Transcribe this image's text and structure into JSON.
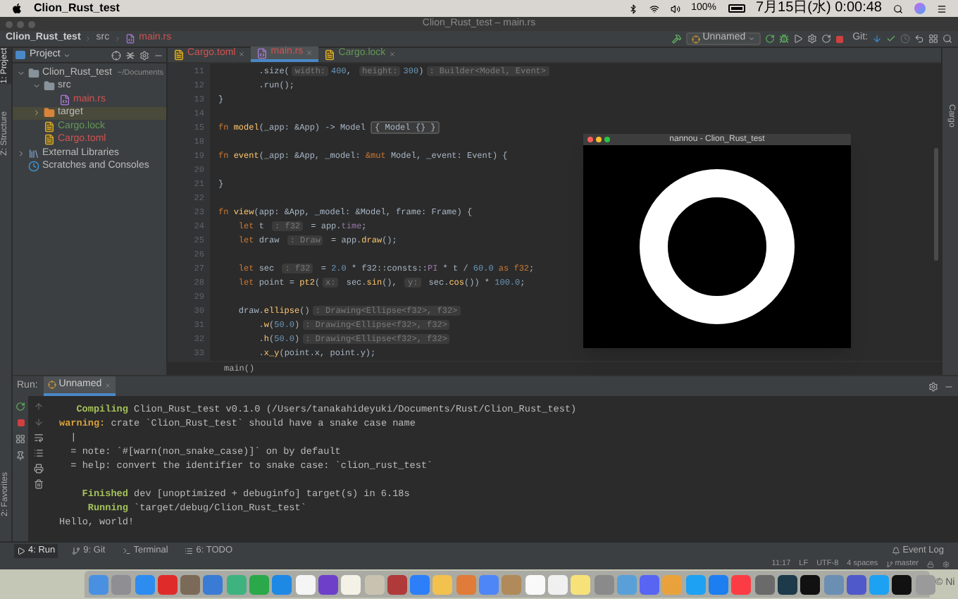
{
  "menu_bar": {
    "app_name": "Clion_Rust_test",
    "battery": "100%",
    "clock": "7月15日(水) 0:00:48"
  },
  "window": {
    "title": "Clion_Rust_test – main.rs"
  },
  "nav_bar": {
    "breadcrumbs": [
      "Clion_Rust_test",
      "src",
      "main.rs"
    ],
    "run_config": "Unnamed",
    "git_label": "Git:"
  },
  "left_strip": [
    {
      "label": "1: Project",
      "selected": true
    },
    {
      "label": "Z: Structure",
      "selected": false
    }
  ],
  "favorites_label": "2: Favorites",
  "right_strip_label": "Cargo",
  "project_panel": {
    "title": "Project",
    "tree": [
      {
        "label": "Clion_Rust_test",
        "path": "~/Documents",
        "kind": "folder",
        "color": "#bbbbbb",
        "selected": false,
        "expanded": true,
        "children": [
          {
            "label": "src",
            "kind": "folder",
            "color": "#bbbbbb",
            "selected": false,
            "expanded": true,
            "children": [
              {
                "label": "main.rs",
                "kind": "rust",
                "color": "#d25252",
                "selected": false
              }
            ]
          },
          {
            "label": "target",
            "kind": "excluded",
            "color": "#bbbbbb",
            "selected": true,
            "expanded": false
          },
          {
            "label": "Cargo.lock",
            "kind": "cargo",
            "color": "#629755",
            "selected": false
          },
          {
            "label": "Cargo.toml",
            "kind": "cargo",
            "color": "#d25252",
            "selected": false
          }
        ]
      },
      {
        "label": "External Libraries",
        "kind": "library",
        "color": "#bbbbbb",
        "selected": false,
        "expanded": false
      },
      {
        "label": "Scratches and Consoles",
        "kind": "scratch",
        "color": "#bbbbbb",
        "selected": false
      }
    ]
  },
  "editor_tabs": [
    {
      "label": "Cargo.toml",
      "kind": "cargo",
      "color": "#d25252",
      "selected": false
    },
    {
      "label": "main.rs",
      "kind": "rust",
      "color": "#d25252",
      "selected": true
    },
    {
      "label": "Cargo.lock",
      "kind": "cargo",
      "color": "#629755",
      "selected": false
    }
  ],
  "code_lines": [
    {
      "number": "11",
      "segments": [
        {
          "kind": "plain",
          "text": "        .size("
        },
        {
          "kind": "hint",
          "text": "width:"
        },
        {
          "kind": "number",
          "text": "400"
        },
        {
          "kind": "plain",
          "text": ", "
        },
        {
          "kind": "hint",
          "text": "height:"
        },
        {
          "kind": "number",
          "text": "300"
        },
        {
          "kind": "plain",
          "text": ")"
        },
        {
          "kind": "hint",
          "text": ": Builder<Model, Event>"
        }
      ]
    },
    {
      "number": "12",
      "segments": [
        {
          "kind": "plain",
          "text": "        .run();"
        }
      ]
    },
    {
      "number": "13",
      "segments": [
        {
          "kind": "plain",
          "text": "}"
        }
      ]
    },
    {
      "number": "14"
    },
    {
      "number": "15",
      "segments": [
        {
          "kind": "keyword",
          "text": "fn "
        },
        {
          "kind": "function",
          "text": "model"
        },
        {
          "kind": "plain",
          "text": "(_app: &App) -> Model "
        },
        {
          "kind": "fold",
          "text": "{ Model {} }"
        }
      ]
    },
    {
      "number": "18"
    },
    {
      "number": "19",
      "segments": [
        {
          "kind": "keyword",
          "text": "fn "
        },
        {
          "kind": "function",
          "text": "event"
        },
        {
          "kind": "plain",
          "text": "(_app: &App, _model: "
        },
        {
          "kind": "keyword",
          "text": "&mut"
        },
        {
          "kind": "plain",
          "text": " Model, _event: Event) {"
        }
      ]
    },
    {
      "number": "20"
    },
    {
      "number": "21",
      "segments": [
        {
          "kind": "plain",
          "text": "}"
        }
      ]
    },
    {
      "number": "22"
    },
    {
      "number": "23",
      "segments": [
        {
          "kind": "keyword",
          "text": "fn "
        },
        {
          "kind": "function",
          "text": "view"
        },
        {
          "kind": "plain",
          "text": "(app: &App, _model: &Model, frame: Frame) {"
        }
      ]
    },
    {
      "number": "24",
      "segments": [
        {
          "kind": "keyword",
          "text": "    let"
        },
        {
          "kind": "plain",
          "text": " t "
        },
        {
          "kind": "hint",
          "text": ": f32"
        },
        {
          "kind": "plain",
          "text": " = app."
        },
        {
          "kind": "field",
          "text": "time"
        },
        {
          "kind": "plain",
          "text": ";"
        }
      ]
    },
    {
      "number": "25",
      "segments": [
        {
          "kind": "keyword",
          "text": "    let"
        },
        {
          "kind": "plain",
          "text": " draw "
        },
        {
          "kind": "hint",
          "text": ": Draw"
        },
        {
          "kind": "plain",
          "text": " = app."
        },
        {
          "kind": "function",
          "text": "draw"
        },
        {
          "kind": "plain",
          "text": "();"
        }
      ]
    },
    {
      "number": "26"
    },
    {
      "number": "27",
      "segments": [
        {
          "kind": "keyword",
          "text": "    let"
        },
        {
          "kind": "plain",
          "text": " sec "
        },
        {
          "kind": "hint",
          "text": ": f32"
        },
        {
          "kind": "plain",
          "text": " = "
        },
        {
          "kind": "number",
          "text": "2.0"
        },
        {
          "kind": "plain",
          "text": " * f32::consts::"
        },
        {
          "kind": "field",
          "text": "PI"
        },
        {
          "kind": "plain",
          "text": " * t / "
        },
        {
          "kind": "number",
          "text": "60.0"
        },
        {
          "kind": "keyword",
          "text": " as f32"
        },
        {
          "kind": "plain",
          "text": ";"
        }
      ]
    },
    {
      "number": "28",
      "segments": [
        {
          "kind": "keyword",
          "text": "    let"
        },
        {
          "kind": "plain",
          "text": " point = "
        },
        {
          "kind": "function",
          "text": "pt2"
        },
        {
          "kind": "plain",
          "text": "("
        },
        {
          "kind": "hint",
          "text": "x:"
        },
        {
          "kind": "plain",
          "text": " sec."
        },
        {
          "kind": "function",
          "text": "sin"
        },
        {
          "kind": "plain",
          "text": "(), "
        },
        {
          "kind": "hint",
          "text": "y:"
        },
        {
          "kind": "plain",
          "text": " sec."
        },
        {
          "kind": "function",
          "text": "cos"
        },
        {
          "kind": "plain",
          "text": "()) * "
        },
        {
          "kind": "number",
          "text": "100.0"
        },
        {
          "kind": "plain",
          "text": ";"
        }
      ]
    },
    {
      "number": "29"
    },
    {
      "number": "30",
      "segments": [
        {
          "kind": "plain",
          "text": "    draw."
        },
        {
          "kind": "function",
          "text": "ellipse"
        },
        {
          "kind": "plain",
          "text": "()"
        },
        {
          "kind": "hint",
          "text": ": Drawing<Ellipse<f32>, f32>"
        }
      ]
    },
    {
      "number": "31",
      "segments": [
        {
          "kind": "plain",
          "text": "        ."
        },
        {
          "kind": "function",
          "text": "w"
        },
        {
          "kind": "plain",
          "text": "("
        },
        {
          "kind": "number",
          "text": "50.0"
        },
        {
          "kind": "plain",
          "text": ")"
        },
        {
          "kind": "hint",
          "text": ": Drawing<Ellipse<f32>, f32>"
        }
      ]
    },
    {
      "number": "32",
      "segments": [
        {
          "kind": "plain",
          "text": "        ."
        },
        {
          "kind": "function",
          "text": "h"
        },
        {
          "kind": "plain",
          "text": "("
        },
        {
          "kind": "number",
          "text": "50.0"
        },
        {
          "kind": "plain",
          "text": ")"
        },
        {
          "kind": "hint",
          "text": ": Drawing<Ellipse<f32>, f32>"
        }
      ]
    },
    {
      "number": "33",
      "segments": [
        {
          "kind": "plain",
          "text": "        ."
        },
        {
          "kind": "function",
          "text": "x_y"
        },
        {
          "kind": "plain",
          "text": "(point.x, point.y);"
        }
      ]
    }
  ],
  "editor_breadcrumb": "main()",
  "app_window": {
    "title": "nannou - Clion_Rust_test"
  },
  "run_panel": {
    "label": "Run:",
    "tab": "Unnamed",
    "lines": [
      {
        "kind": "status",
        "label": "Compiling",
        "text": "Clion_Rust_test v0.1.0 (/Users/tanakahideyuki/Documents/Rust/Clion_Rust_test)"
      },
      {
        "kind": "warning",
        "label": "warning:",
        "text": "crate `Clion_Rust_test` should have a snake case name"
      },
      {
        "kind": "detail",
        "text": "|"
      },
      {
        "kind": "detail",
        "text": "= note: `#[warn(non_snake_case)]` on by default"
      },
      {
        "kind": "detail",
        "text": "= help: convert the identifier to snake case: `clion_rust_test`"
      },
      {
        "kind": "blank"
      },
      {
        "kind": "status",
        "label": "Finished",
        "text": "dev [unoptimized + debuginfo] target(s) in 6.18s"
      },
      {
        "kind": "status",
        "label": "Running",
        "text": "`target/debug/Clion_Rust_test`"
      },
      {
        "kind": "plain",
        "text": "Hello, world!"
      }
    ]
  },
  "tool_tabs": [
    {
      "label": "4: Run",
      "kind": "run",
      "selected": true
    },
    {
      "label": "9: Git",
      "kind": "git",
      "selected": false
    },
    {
      "label": "Terminal",
      "kind": "terminal",
      "selected": false
    },
    {
      "label": "6: TODO",
      "kind": "todo",
      "selected": false
    }
  ],
  "event_log": "Event Log",
  "status_bar": {
    "items": [
      "11:17",
      "LF",
      "UTF-8",
      "4 spaces"
    ],
    "branch": "master"
  },
  "desktop_text": "© Ni"
}
